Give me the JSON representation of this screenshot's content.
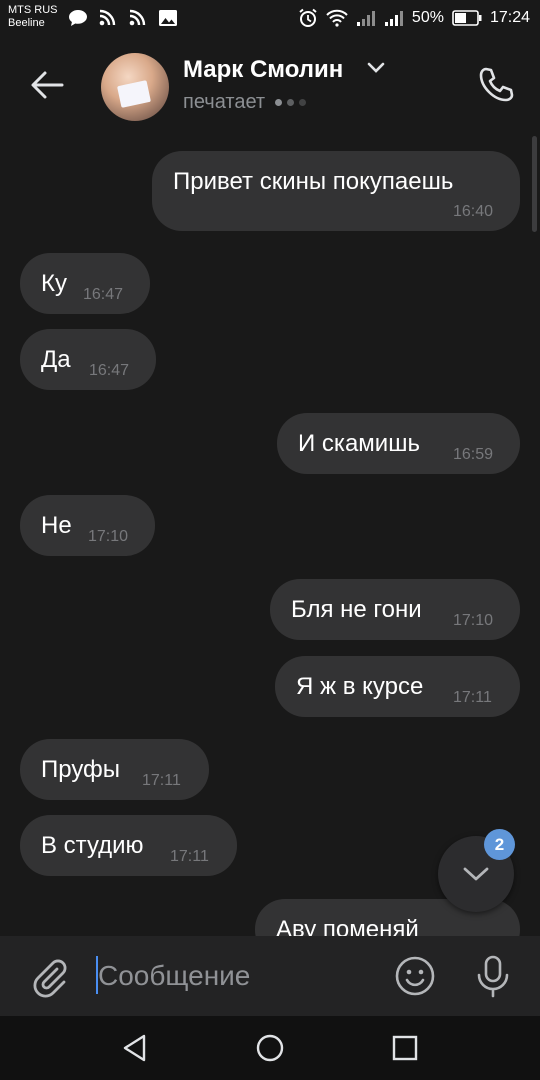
{
  "status_bar": {
    "carrier_1": "MTS RUS",
    "carrier_2": "Beeline",
    "battery": "50%",
    "time": "17:24",
    "icons": [
      "chat-bubble-icon",
      "rss-icon",
      "rss-icon",
      "image-icon",
      "alarm-icon",
      "wifi-icon",
      "signal-icon",
      "signal-icon",
      "battery-icon"
    ]
  },
  "header": {
    "contact_name": "Марк Смолин",
    "status": "печатает",
    "icons": [
      "back-arrow-icon",
      "chevron-down-icon",
      "phone-icon"
    ]
  },
  "messages": [
    {
      "direction": "outgoing",
      "text": "Привет скины покупаешь",
      "time": "16:40"
    },
    {
      "direction": "incoming",
      "text": "Ку",
      "time": "16:47"
    },
    {
      "direction": "incoming",
      "text": "Да",
      "time": "16:47"
    },
    {
      "direction": "outgoing",
      "text": "И скамишь",
      "time": "16:59"
    },
    {
      "direction": "incoming",
      "text": "Не",
      "time": "17:10"
    },
    {
      "direction": "outgoing",
      "text": "Бля не гони",
      "time": "17:10"
    },
    {
      "direction": "outgoing",
      "text": "Я ж в курсе",
      "time": "17:11"
    },
    {
      "direction": "incoming",
      "text": "Пруфы",
      "time": "17:11"
    },
    {
      "direction": "incoming",
      "text": "В студию",
      "time": "17:11"
    },
    {
      "direction": "outgoing",
      "text": "Аву поменяй",
      "time": ""
    }
  ],
  "scroll_down": {
    "badge": "2",
    "icon": "chevron-down-icon"
  },
  "composer": {
    "placeholder": "Сообщение",
    "value": "",
    "icons": [
      "paperclip-icon",
      "emoji-icon",
      "microphone-icon"
    ]
  },
  "navbar": {
    "icons": [
      "back-triangle-icon",
      "home-circle-icon",
      "recents-square-icon"
    ]
  },
  "colors": {
    "background": "#191919",
    "bubble": "#333334",
    "accent": "#5f96d9",
    "timestamp": "#77787b"
  }
}
